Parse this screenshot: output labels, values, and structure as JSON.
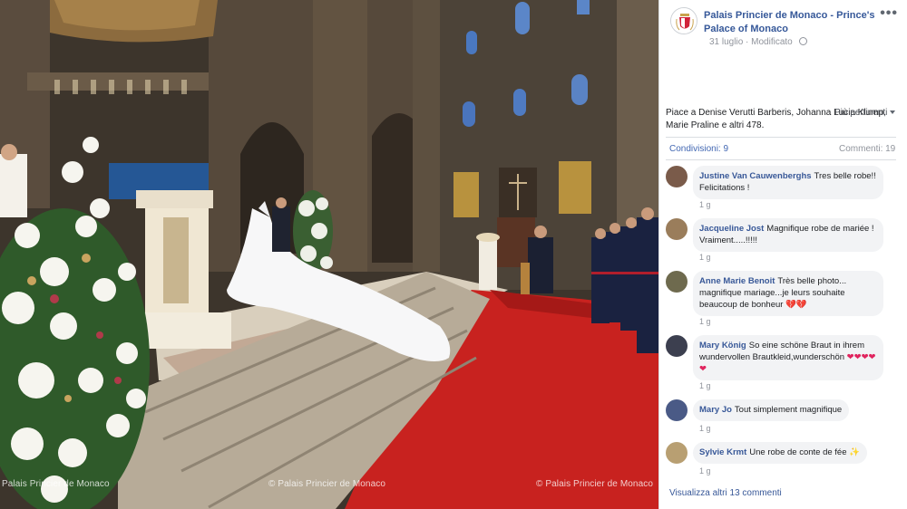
{
  "photo": {
    "watermarks": [
      "Palais Princier de Monaco",
      "© Palais Princier de Monaco",
      "© Palais Princier de Monaco"
    ]
  },
  "post": {
    "page_name": "Palais Princier de Monaco - Prince's Palace of Monaco",
    "date": "31 luglio",
    "edited": "Modificato",
    "likes_text": "Piace a Denise Verutti Barberis, Johanna Lucia Klump, Marie Praline e altri 478.",
    "sort_label": "Più pertinenti",
    "shares": "Condivisioni: 9",
    "comments_count": "Commenti: 19",
    "view_more": "Visualizza altri 13 commenti"
  },
  "comments": [
    {
      "author": "Justine Van Cauwenberghs",
      "text": "Tres belle robe!! Felicitations !",
      "age": "1 g",
      "avatar_color": "#7a5b4a"
    },
    {
      "author": "Jacqueline Jost",
      "text": "Magnifique robe de mariée ! Vraiment.....!!!!!",
      "age": "1 g",
      "avatar_color": "#9a7d5b"
    },
    {
      "author": "Anne Marie Benoit",
      "text": "Très belle photo... magnifique mariage...je leurs souhaite beaucoup de bonheur",
      "age": "1 g",
      "avatar_color": "#6e6a4e"
    },
    {
      "author": "Mary König",
      "text": "So eine schöne Braut in ihrem wundervollen Brautkleid,wunderschön",
      "age": "1 g",
      "avatar_color": "#3c3f4f"
    },
    {
      "author": "Mary Jo",
      "text": "Tout simplement magnifique",
      "age": "1 g",
      "avatar_color": "#4a5a86"
    },
    {
      "author": "Sylvie Krmt",
      "text": "Une robe de conte de fée",
      "age": "1 g",
      "avatar_color": "#b89f72"
    }
  ],
  "icons": [
    "more-options-icon",
    "globe-icon",
    "caret-down-icon",
    "broken-heart-emoji",
    "heart-emoji",
    "sparkle-emoji"
  ]
}
